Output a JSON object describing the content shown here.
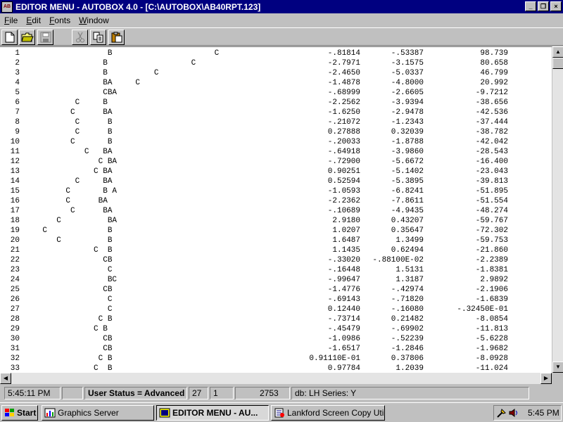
{
  "window": {
    "icon_text": "AB",
    "title": "EDITOR MENU - AUTOBOX 4.0 - [C:\\AUTOBOX\\AB40RPT.123]",
    "buttons": [
      "_",
      "❐",
      "×"
    ]
  },
  "menu": [
    "File",
    "Edit",
    "Fonts",
    "Window"
  ],
  "toolbar": {
    "tools": [
      {
        "icon": "new-file-icon"
      },
      {
        "icon": "open-folder-icon"
      },
      {
        "icon": "save-disk-icon",
        "disabled": true
      },
      {
        "icon": "cut-scissors-icon",
        "disabled": true
      },
      {
        "icon": "copy-icon"
      },
      {
        "icon": "paste-clipboard-icon"
      }
    ]
  },
  "report": {
    "rows": [
      {
        "n": "1",
        "plot": "                  B                      C",
        "v1": "-.81814",
        "v2": "-.53387",
        "v3": "98.739"
      },
      {
        "n": "2",
        "plot": "                 B                  C",
        "v1": "-2.7971",
        "v2": "-3.1575",
        "v3": "80.658"
      },
      {
        "n": "3",
        "plot": "                 B          C",
        "v1": "-2.4650",
        "v2": "-5.0337",
        "v3": "46.799"
      },
      {
        "n": "4",
        "plot": "                 BA     C",
        "v1": "-1.4878",
        "v2": "-4.8000",
        "v3": "20.992"
      },
      {
        "n": "5",
        "plot": "                 CBA",
        "v1": "-.68999",
        "v2": "-2.6605",
        "v3": "-9.7212"
      },
      {
        "n": "6",
        "plot": "           C     B",
        "v1": "-2.2562",
        "v2": "-3.9394",
        "v3": "-38.656"
      },
      {
        "n": "7",
        "plot": "          C      BA",
        "v1": "-1.6250",
        "v2": "-2.9478",
        "v3": "-42.536"
      },
      {
        "n": "8",
        "plot": "           C      B",
        "v1": "-.21072",
        "v2": "-1.2343",
        "v3": "-37.444"
      },
      {
        "n": "9",
        "plot": "           C      B",
        "v1": "0.27888",
        "v2": "0.32039",
        "v3": "-38.782"
      },
      {
        "n": "10",
        "plot": "          C       B",
        "v1": "-.20033",
        "v2": "-1.8788",
        "v3": "-42.042"
      },
      {
        "n": "11",
        "plot": "             C   BA",
        "v1": "-.64918",
        "v2": "-3.9860",
        "v3": "-28.543"
      },
      {
        "n": "12",
        "plot": "                C BA",
        "v1": "-.72900",
        "v2": "-5.6672",
        "v3": "-16.400"
      },
      {
        "n": "13",
        "plot": "               C BA",
        "v1": "0.90251",
        "v2": "-5.1402",
        "v3": "-23.043"
      },
      {
        "n": "14",
        "plot": "           C     BA",
        "v1": "0.52594",
        "v2": "-5.3895",
        "v3": "-39.813"
      },
      {
        "n": "15",
        "plot": "         C       B A",
        "v1": "-1.0593",
        "v2": "-6.8241",
        "v3": "-51.895"
      },
      {
        "n": "16",
        "plot": "         C      BA",
        "v1": "-2.2362",
        "v2": "-7.8611",
        "v3": "-51.554"
      },
      {
        "n": "17",
        "plot": "          C      BA",
        "v1": "-.10689",
        "v2": "-4.9435",
        "v3": "-48.274"
      },
      {
        "n": "18",
        "plot": "       C          BA",
        "v1": "2.9180",
        "v2": "0.43207",
        "v3": "-59.767"
      },
      {
        "n": "19",
        "plot": "    C             B",
        "v1": "1.0207",
        "v2": "0.35647",
        "v3": "-72.302"
      },
      {
        "n": "20",
        "plot": "       C          B",
        "v1": "1.6487",
        "v2": "1.3499",
        "v3": "-59.753"
      },
      {
        "n": "21",
        "plot": "               C  B",
        "v1": "1.1435",
        "v2": "0.62494",
        "v3": "-21.860"
      },
      {
        "n": "22",
        "plot": "                 CB",
        "v1": "-.33020",
        "v2": "-.88100E-02",
        "v3": "-2.2389"
      },
      {
        "n": "23",
        "plot": "                  C",
        "v1": "-.16448",
        "v2": "1.5131",
        "v3": "-1.8381"
      },
      {
        "n": "24",
        "plot": "                  BC",
        "v1": "-.99647",
        "v2": "1.3187",
        "v3": "2.9892"
      },
      {
        "n": "25",
        "plot": "                 CB",
        "v1": "-1.4776",
        "v2": "-.42974",
        "v3": "-2.1906"
      },
      {
        "n": "26",
        "plot": "                  C",
        "v1": "-.69143",
        "v2": "-.71820",
        "v3": "-1.6839"
      },
      {
        "n": "27",
        "plot": "                  C",
        "v1": "0.12440",
        "v2": "-.16080",
        "v3": "-.32450E-01"
      },
      {
        "n": "28",
        "plot": "                C B",
        "v1": "-.73714",
        "v2": "0.21482",
        "v3": "-8.0854"
      },
      {
        "n": "29",
        "plot": "               C B",
        "v1": "-.45479",
        "v2": "-.69902",
        "v3": "-11.813"
      },
      {
        "n": "30",
        "plot": "                 CB",
        "v1": "-1.0986",
        "v2": "-.52239",
        "v3": "-5.6228"
      },
      {
        "n": "31",
        "plot": "                 CB",
        "v1": "-1.6517",
        "v2": "-1.2846",
        "v3": "-1.9682"
      },
      {
        "n": "32",
        "plot": "                C B",
        "v1": "0.91110E-01",
        "v2": "0.37806",
        "v3": "-8.0928"
      },
      {
        "n": "33",
        "plot": "               C  B",
        "v1": "0.97784",
        "v2": "1.2039",
        "v3": "-11.024"
      }
    ]
  },
  "statusbar": {
    "time": "5:45:11 PM",
    "blank": "",
    "user_status": "User Status = Advanced",
    "field1": "27",
    "field2": "1",
    "field3": "2753",
    "series": "db: LH Series: Y"
  },
  "taskbar": {
    "start_label": "Start",
    "tasks": [
      {
        "label": "Graphics Server",
        "icon": "graphics-server-icon"
      },
      {
        "label": "EDITOR MENU - AU...",
        "icon": "autobox-app-icon",
        "active": true
      },
      {
        "label": "Lankford Screen Copy Utility",
        "icon": "screen-copy-icon"
      }
    ],
    "clock": "5:45 PM"
  },
  "colors": {
    "titlebar": "#000080",
    "face": "#c0c0c0",
    "editor_bg": "#ffffff"
  }
}
